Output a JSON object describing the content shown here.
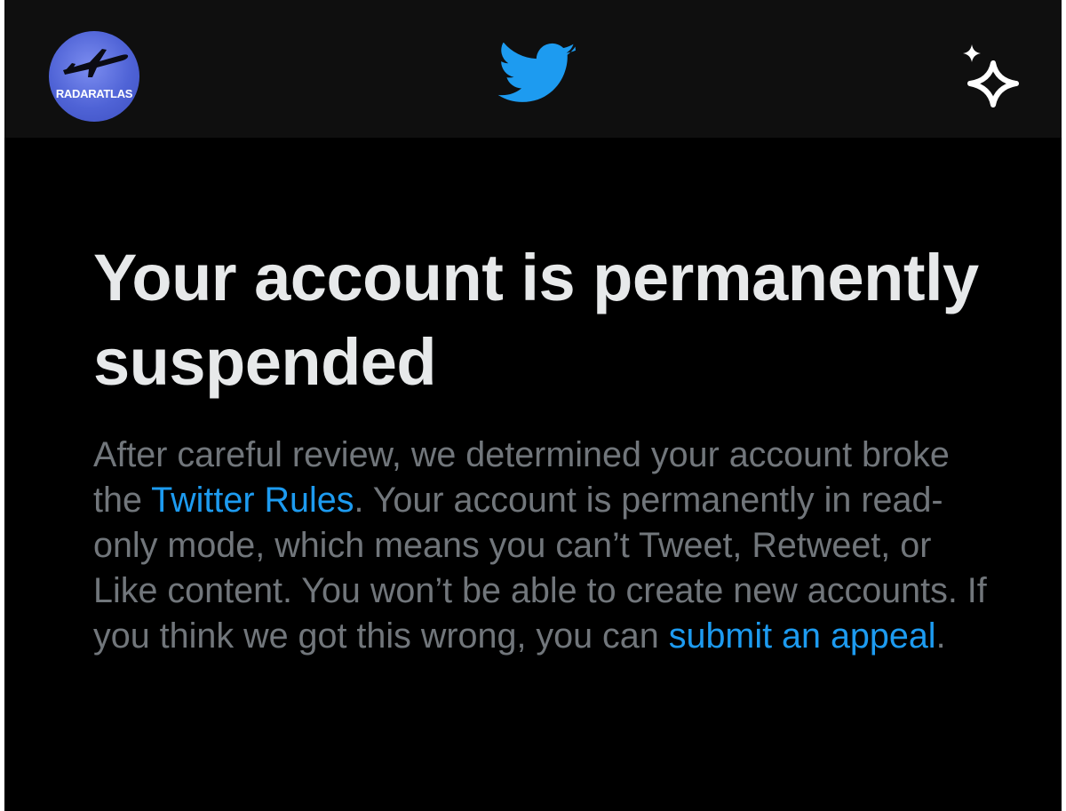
{
  "header": {
    "avatar": {
      "brand_text": "RADARATLAS",
      "icon": "airplane-icon",
      "background_color": "#4f63d6"
    },
    "logo": {
      "icon": "twitter-bird-icon",
      "color": "#1d9bf0"
    },
    "sparkle_button": {
      "icon": "sparkle-icon",
      "color": "#ffffff"
    }
  },
  "main": {
    "title": "Your account is permanently suspended",
    "message": {
      "part1": "After careful review, we determined your account broke the ",
      "rules_link": "Twitter Rules",
      "part2": ". Your account is permanently in read-only mode, which means you can’t Tweet, Retweet, or Like content. You won’t be able to create new accounts. If you think we got this wrong, you can ",
      "appeal_link": "submit an appeal",
      "part3": "."
    }
  },
  "colors": {
    "background": "#000000",
    "header_background": "#0f0f0f",
    "title_text": "#e7e9ea",
    "body_text": "#71767b",
    "link": "#1d9bf0"
  }
}
